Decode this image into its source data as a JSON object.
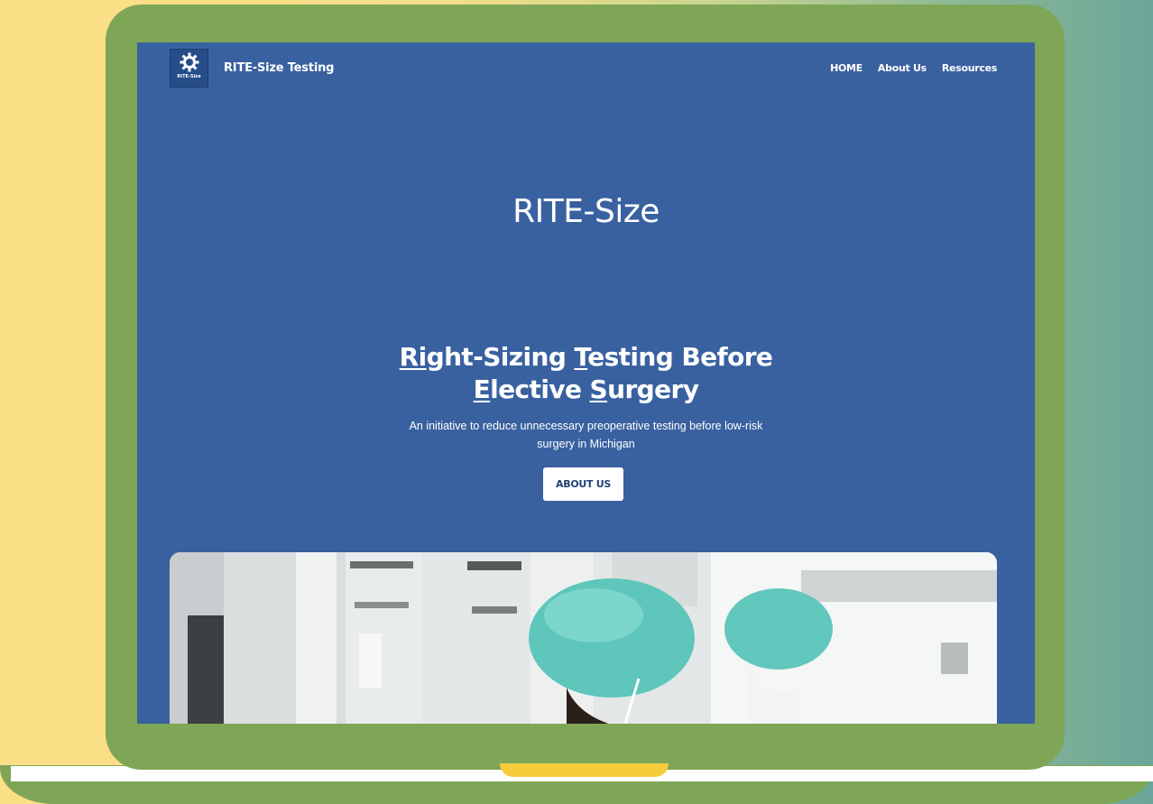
{
  "site": {
    "logo_text": "RITE-Size",
    "brand": "RITE-Size Testing"
  },
  "nav": {
    "items": [
      "HOME",
      "About Us",
      "Resources"
    ]
  },
  "hero": {
    "title": "RITE-Size",
    "headline_line1": [
      {
        "text": "Ri",
        "underline": true
      },
      {
        "text": "ght-Sizing ",
        "underline": false
      },
      {
        "text": "T",
        "underline": true
      },
      {
        "text": "esting Before",
        "underline": false
      }
    ],
    "headline_line2": [
      {
        "text": "E",
        "underline": true
      },
      {
        "text": "lective ",
        "underline": false
      },
      {
        "text": "S",
        "underline": true
      },
      {
        "text": "urgery",
        "underline": false
      }
    ],
    "subtitle": "An initiative to reduce unnecessary preoperative testing before low-risk surgery in Michigan",
    "cta_label": "ABOUT US"
  },
  "colors": {
    "screen_bg": "#3961a0",
    "frame": "#7ea656",
    "cap_teal": "#5ec6bb",
    "notch": "#f6cc3d"
  },
  "image": {
    "subject": "clinicians in surgical caps and masks in a pharmacy"
  }
}
